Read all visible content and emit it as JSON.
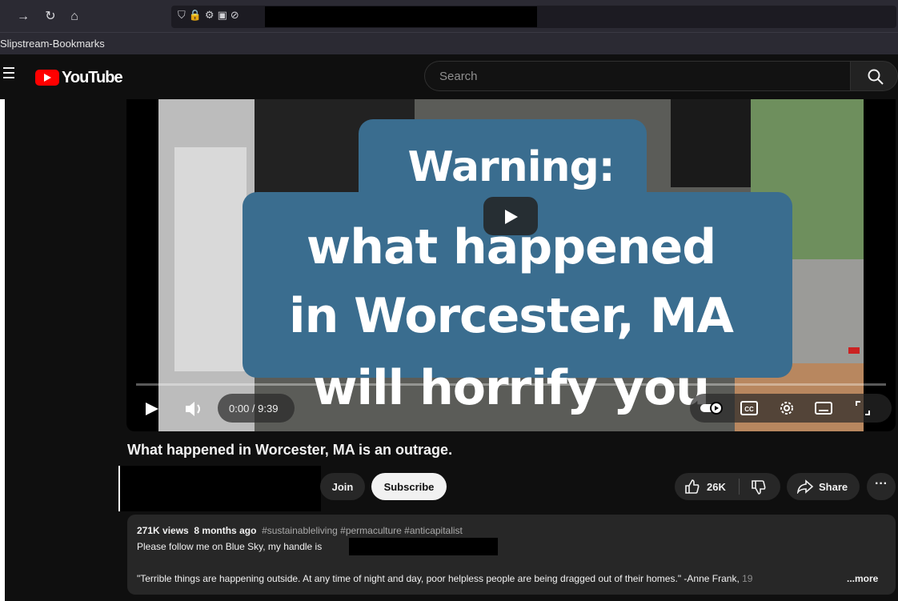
{
  "browser": {
    "bookmarks_label": "Slipstream-Bookmarks"
  },
  "header": {
    "logo_text": "YouTube",
    "search_placeholder": "Search"
  },
  "video": {
    "overlay_lines": [
      "Warning:",
      "what happened",
      "in Worcester, MA",
      "will horrify you"
    ],
    "time": "0:00 / 9:39",
    "progress": 0
  },
  "watch": {
    "title": "What happened in Worcester, MA is an outrage.",
    "join_label": "Join",
    "subscribe_label": "Subscribe",
    "like_count": "26K",
    "share_label": "Share"
  },
  "description": {
    "views": "271K views",
    "age": "8 months ago",
    "hashtags": "#sustainableliving #permaculture #anticapitalist",
    "line1": "Please follow me on Blue Sky, my handle is",
    "quote": "\"Terrible things are happening outside. At any time of night and day, poor helpless people are being dragged out of their homes.\" -Anne Frank, ",
    "quote_fade": "19",
    "more_label": "...more"
  },
  "colors": {
    "brand_red": "#ff0000",
    "overlay_blue": "#3a6d8f",
    "background": "#0f0f0f"
  }
}
